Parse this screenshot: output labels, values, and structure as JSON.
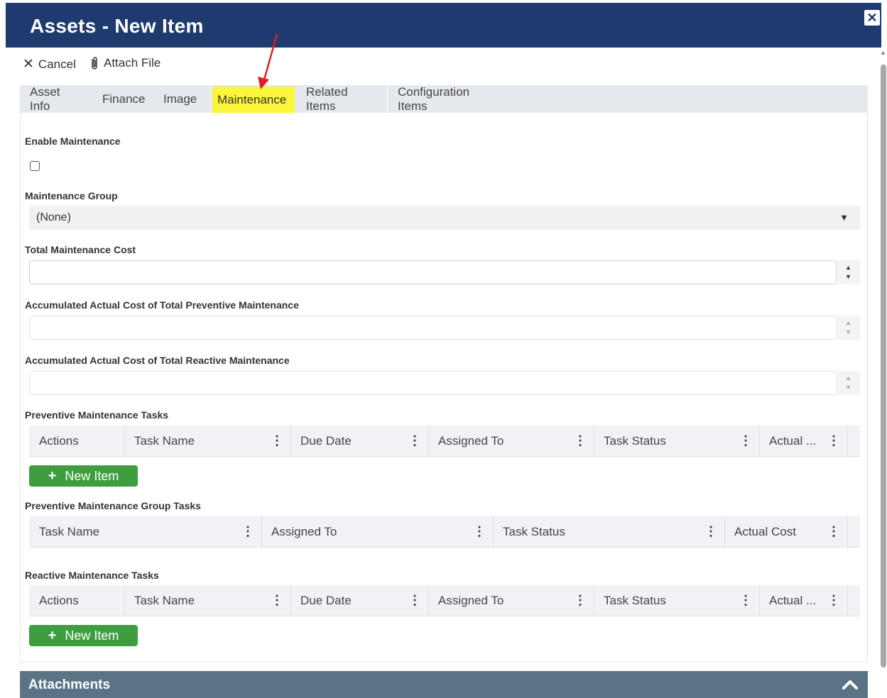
{
  "dialog": {
    "title": "Assets - New Item"
  },
  "toolbar": {
    "cancel_label": "Cancel",
    "attach_label": "Attach File"
  },
  "tabs": [
    {
      "label": "Asset Info"
    },
    {
      "label": "Finance"
    },
    {
      "label": "Image"
    },
    {
      "label": "Maintenance",
      "active": true
    },
    {
      "label": "Related Items"
    },
    {
      "label": "Configuration Items"
    }
  ],
  "form": {
    "enable_maintenance_label": "Enable Maintenance",
    "enable_maintenance_checked": false,
    "maintenance_group_label": "Maintenance Group",
    "maintenance_group_value": "(None)",
    "total_cost_label": "Total Maintenance Cost",
    "total_cost_value": "",
    "preventive_cost_label": "Accumulated Actual Cost of Total Preventive Maintenance",
    "preventive_cost_value": "",
    "reactive_cost_label": "Accumulated Actual Cost of Total Reactive Maintenance",
    "reactive_cost_value": ""
  },
  "preventive_tasks": {
    "label": "Preventive Maintenance Tasks",
    "columns": [
      "Actions",
      "Task Name",
      "Due Date",
      "Assigned To",
      "Task Status",
      "Actual ..."
    ],
    "new_item_label": "New Item"
  },
  "preventive_group_tasks": {
    "label": "Preventive Maintenance Group Tasks",
    "columns": [
      "Task Name",
      "Assigned To",
      "Task Status",
      "Actual Cost"
    ]
  },
  "reactive_tasks": {
    "label": "Reactive Maintenance Tasks",
    "columns": [
      "Actions",
      "Task Name",
      "Due Date",
      "Assigned To",
      "Task Status",
      "Actual ..."
    ],
    "new_item_label": "New Item"
  },
  "attachments": {
    "title": "Attachments"
  },
  "colors": {
    "title_bar": "#1f3a6e",
    "active_tab_highlight": "#fbf53b",
    "new_item_button": "#3e9d3e",
    "attachments_bar": "#5b7485",
    "annotation_arrow": "#e02020"
  }
}
